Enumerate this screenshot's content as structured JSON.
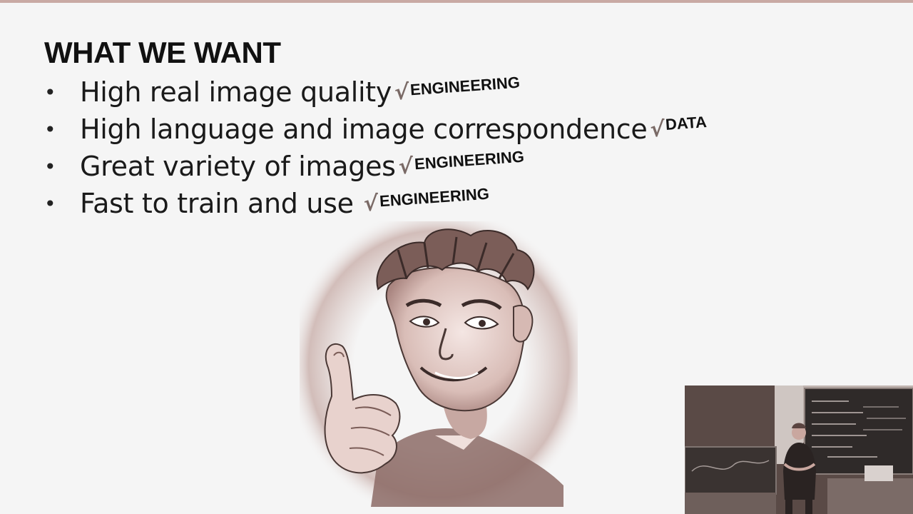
{
  "slide": {
    "title": "WHAT WE WANT",
    "bullet_glyph": "•",
    "check_glyph": "√",
    "bullets": [
      {
        "text": "High real image quality",
        "tag": "ENGINEERING"
      },
      {
        "text": "High language and image correspondence",
        "tag": "DATA"
      },
      {
        "text": "Great variety of images",
        "tag": "ENGINEERING"
      },
      {
        "text": "Fast to train and use",
        "tag": "ENGINEERING"
      }
    ]
  },
  "illustration": {
    "icon": "thumbs-up-guy-drawing"
  },
  "video_inset": {
    "icon": "lecturer-camera-feed"
  },
  "colors": {
    "background": "#f5f5f5",
    "title": "#111111",
    "check": "#7a6a66",
    "drawing_tint": "#c4a39c"
  }
}
